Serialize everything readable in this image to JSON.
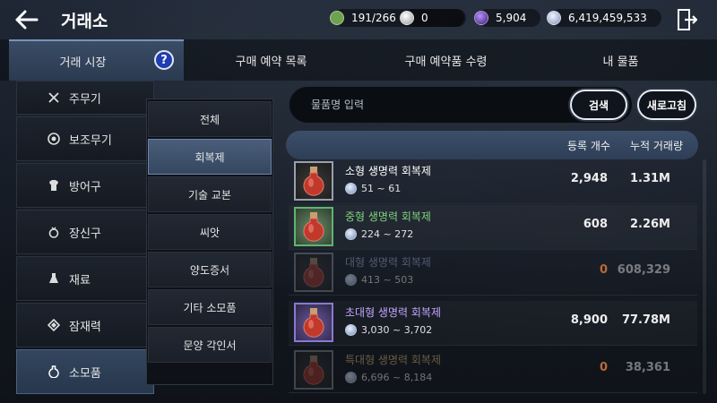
{
  "header": {
    "title": "거래소",
    "currencies": [
      {
        "name": "energy",
        "value": "191/266",
        "color": "#6fa24e"
      },
      {
        "name": "pearl",
        "value": "0",
        "color": "#d8d8d8"
      },
      {
        "name": "black-gem",
        "value": "5,904",
        "color": "#6a3fb5"
      },
      {
        "name": "silver",
        "value": "6,419,459,533",
        "color": "#a9b8d6"
      }
    ]
  },
  "tabs": [
    {
      "label": "거래 시장",
      "active": true
    },
    {
      "label": "구매 예약 목록",
      "active": false
    },
    {
      "label": "구매 예약품 수령",
      "active": false
    },
    {
      "label": "내 물품",
      "active": false
    }
  ],
  "categories": [
    {
      "label": "주무기",
      "icon": "swords-icon",
      "active": false
    },
    {
      "label": "보조무기",
      "icon": "shield-icon",
      "active": false
    },
    {
      "label": "방어구",
      "icon": "armor-icon",
      "active": false
    },
    {
      "label": "장신구",
      "icon": "ring-icon",
      "active": false
    },
    {
      "label": "재료",
      "icon": "flask-icon",
      "active": false
    },
    {
      "label": "잠재력",
      "icon": "diamond-icon",
      "active": false
    },
    {
      "label": "소모품",
      "icon": "potion-icon",
      "active": true
    }
  ],
  "subcategories": [
    {
      "label": "전체",
      "active": false
    },
    {
      "label": "회복제",
      "active": true
    },
    {
      "label": "기술 교본",
      "active": false
    },
    {
      "label": "씨앗",
      "active": false
    },
    {
      "label": "양도증서",
      "active": false
    },
    {
      "label": "기타 소모품",
      "active": false
    },
    {
      "label": "문양 각인서",
      "active": false
    }
  ],
  "search": {
    "placeholder": "물품명 입력",
    "search_label": "검색",
    "refresh_label": "새로고침"
  },
  "table": {
    "col_count": "등록 개수",
    "col_volume": "누적 거래량",
    "rows": [
      {
        "name": "소형 생명력 회복제",
        "price": "51 ~ 61",
        "count": "2,948",
        "volume": "1.31M",
        "name_color": "#ffffff",
        "grade": "white",
        "dim": false
      },
      {
        "name": "중형 생명력 회복제",
        "price": "224 ~ 272",
        "count": "608",
        "volume": "2.26M",
        "name_color": "#7ed37e",
        "grade": "green",
        "dim": false
      },
      {
        "name": "대형 생명력 회복제",
        "price": "413 ~ 503",
        "count": "0",
        "volume": "608,329",
        "name_color": "#8fa6c8",
        "grade": "blue",
        "dim": true
      },
      {
        "name": "초대형 생명력 회복제",
        "price": "3,030 ~ 3,702",
        "count": "8,900",
        "volume": "77.78M",
        "name_color": "#c2a4ff",
        "grade": "purple",
        "dim": false
      },
      {
        "name": "특대형 생명력 회복제",
        "price": "6,696 ~ 8,184",
        "count": "0",
        "volume": "38,361",
        "name_color": "#d8b070",
        "grade": "gold",
        "dim": true
      }
    ]
  }
}
